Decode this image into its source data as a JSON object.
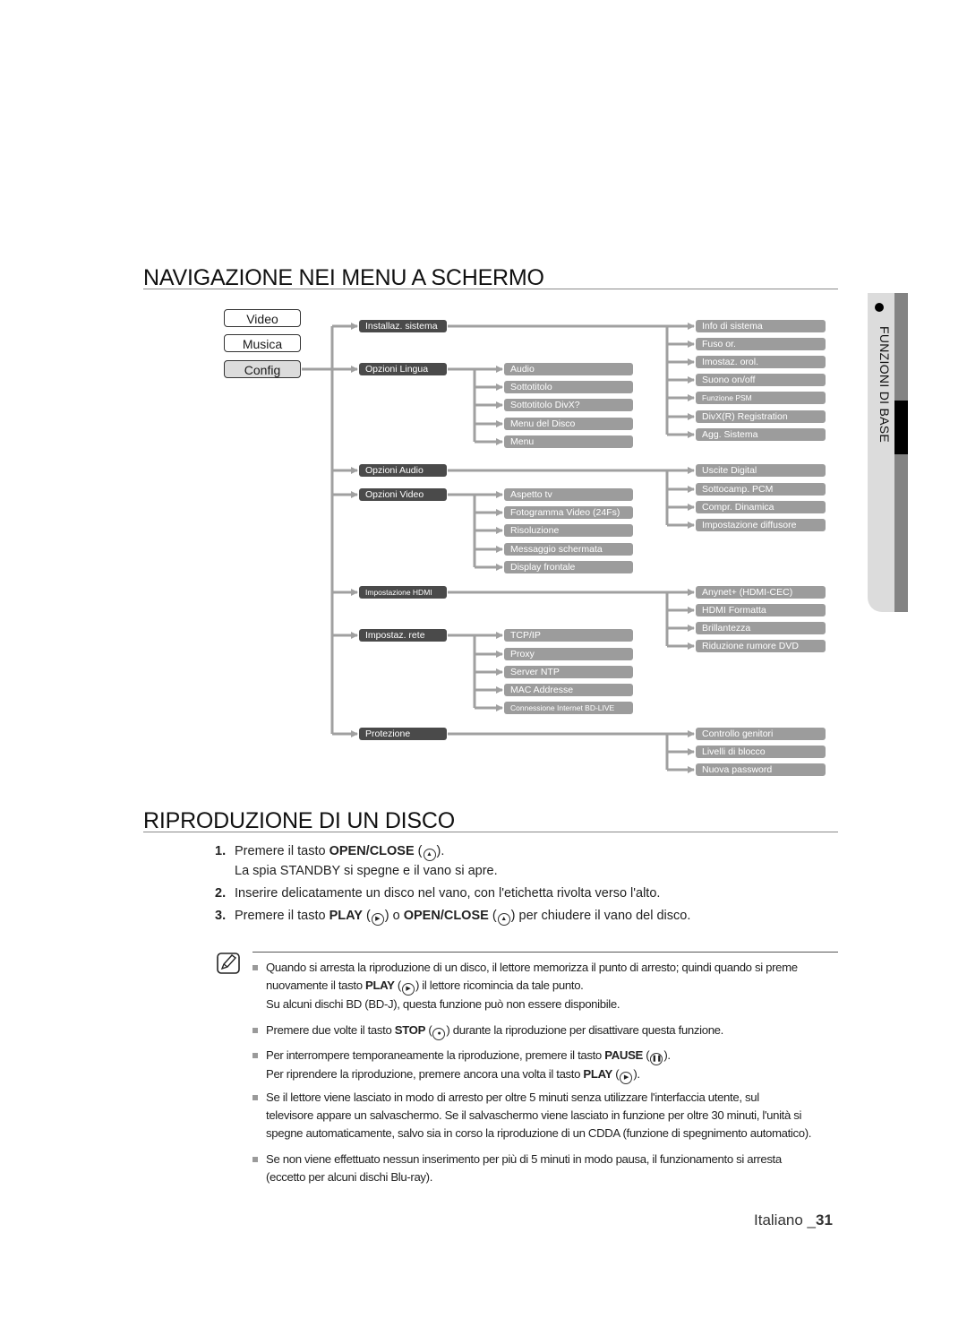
{
  "section1": {
    "title": "NAVIGAZIONE NEI MENU A SCHERMO"
  },
  "root_menu": [
    {
      "label": "Video",
      "active": false
    },
    {
      "label": "Musica",
      "active": false
    },
    {
      "label": "Config",
      "active": true
    }
  ],
  "config_tree": {
    "installaz_sistema": {
      "label": "Installaz. sistema",
      "children": [
        "Info di sistema",
        "Fuso or.",
        "Imostaz. orol.",
        "Suono on/off",
        "Funzione PSM",
        "DivX(R) Registration",
        "Agg. Sistema"
      ]
    },
    "opzioni_lingua": {
      "label": "Opzioni Lingua",
      "children": [
        "Audio",
        "Sottotitolo",
        "Sottotitolo DivX?",
        "Menu del Disco",
        "Menu"
      ]
    },
    "opzioni_audio": {
      "label": "Opzioni Audio",
      "children": [
        "Uscite Digital",
        "Sottocamp. PCM",
        "Compr. Dinamica",
        "Impostazione diffusore"
      ]
    },
    "opzioni_video": {
      "label": "Opzioni Video",
      "children": [
        "Aspetto tv",
        "Fotogramma Video (24Fs)",
        "Risoluzione",
        "Messaggio schermata",
        "Display frontale"
      ]
    },
    "impostazione_hdmi": {
      "label": "Impostazione HDMI",
      "children": [
        "Anynet+ (HDMI-CEC)",
        "HDMI Formatta",
        "Brillantezza",
        "Riduzione rumore DVD"
      ]
    },
    "impostaz_rete": {
      "label": "Impostaz. rete",
      "children": [
        "TCP/IP",
        "Proxy",
        "Server NTP",
        "MAC Addresse",
        "Connessione Internet BD-LIVE"
      ]
    },
    "protezione": {
      "label": "Protezione",
      "children": [
        "Controllo genitori",
        "Livelli di blocco",
        "Nuova password"
      ]
    }
  },
  "side_tab": {
    "label": "FUNZIONI DI BASE"
  },
  "section2": {
    "title": "RIPRODUZIONE DI UN DISCO",
    "steps": [
      {
        "num": "1.",
        "pre": "Premere il tasto ",
        "key": "OPEN/CLOSE",
        "icon": "eject",
        "post": ").",
        "line2": "La spia STANDBY si spegne e il vano si apre."
      },
      {
        "num": "2.",
        "text": "Inserire delicatamente un disco nel vano, con l'etichetta rivolta verso l'alto."
      },
      {
        "num": "3.",
        "pre": "Premere il tasto ",
        "key1": "PLAY",
        "mid": ") o ",
        "key2": "OPEN/CLOSE",
        "post": ") per chiudere il vano del disco."
      }
    ]
  },
  "notes": [
    {
      "l1": "Quando si arresta la riproduzione di un disco, il lettore memorizza il punto di arresto; quindi quando si preme",
      "l2_pre": "nuovamente il tasto ",
      "l2_key": "PLAY",
      "l2_post": ") il lettore ricomincia da tale punto.",
      "l3": "Su alcuni dischi BD (BD-J), questa funzione può non essere disponibile."
    },
    {
      "pre": "Premere due volte il tasto ",
      "key": "STOP",
      "post": ") durante la riproduzione per disattivare questa funzione."
    },
    {
      "l1_pre": "Per interrompere temporaneamente la riproduzione, premere il tasto ",
      "l1_key": "PAUSE",
      "l1_post": ").",
      "l2_pre": "Per riprendere la riproduzione, premere ancora una volta il tasto ",
      "l2_key": "PLAY",
      "l2_post": ")."
    },
    {
      "l1": "Se il lettore viene lasciato in modo di arresto per oltre 5 minuti senza utilizzare l'interfaccia utente, sul",
      "l2": "televisore appare un salvaschermo. Se il salvaschermo viene lasciato in funzione per oltre 30 minuti, l'unità si",
      "l3": "spegne automaticamente, salvo sia in corso la riproduzione di un CDDA (funzione di spegnimento automatico)."
    },
    {
      "l1": "Se non viene effettuato nessun inserimento per più di 5 minuti in modo pausa, il funzionamento si arresta",
      "l2": "(eccetto per alcuni dischi Blu-ray)."
    }
  ],
  "footer": {
    "language": "Italiano _",
    "page": "31"
  },
  "colors": {
    "dark_node": "#4a4a4a",
    "light_node": "#9c9c9c",
    "connector": "#a0a0a0",
    "side_tab": "#dcdcdc"
  }
}
